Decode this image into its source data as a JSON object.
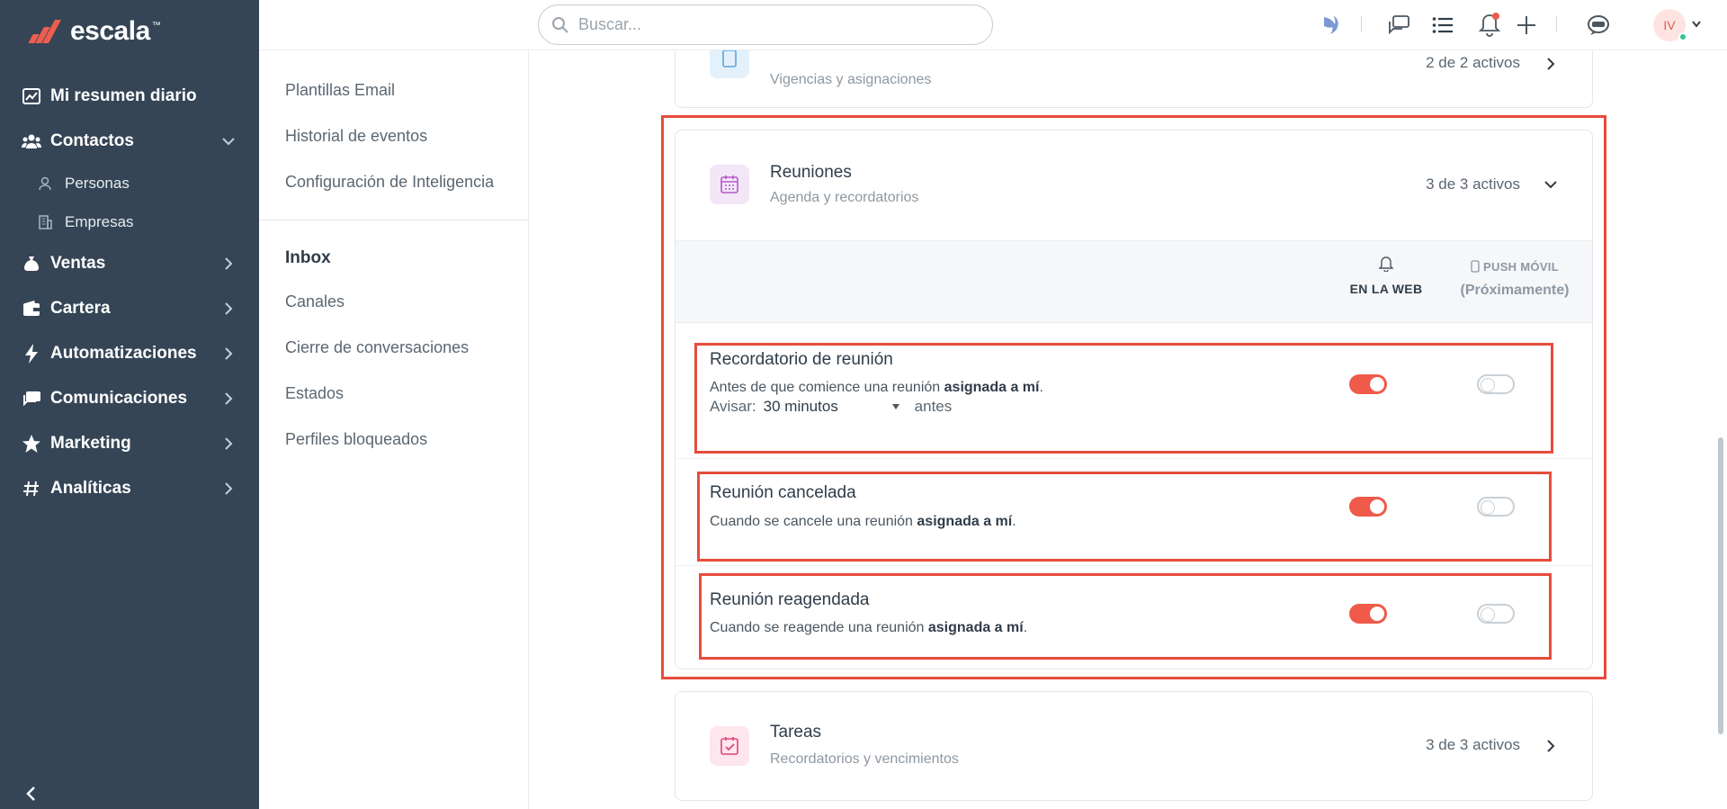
{
  "brand": {
    "name": "escala",
    "tm": "™"
  },
  "sidebar": {
    "items": [
      {
        "label": "Mi resumen diario",
        "icon": "chart-icon"
      },
      {
        "label": "Contactos",
        "icon": "contacts-icon",
        "expanded": true,
        "children": [
          {
            "label": "Personas",
            "icon": "person-icon"
          },
          {
            "label": "Empresas",
            "icon": "building-icon"
          }
        ]
      },
      {
        "label": "Ventas",
        "icon": "money-bag-icon"
      },
      {
        "label": "Cartera",
        "icon": "wallet-icon"
      },
      {
        "label": "Automatizaciones",
        "icon": "bolt-icon"
      },
      {
        "label": "Comunicaciones",
        "icon": "chat-icon"
      },
      {
        "label": "Marketing",
        "icon": "star-icon"
      },
      {
        "label": "Analíticas",
        "icon": "hash-icon"
      }
    ]
  },
  "submenu": {
    "links_top": [
      "Plantillas Email",
      "Historial de eventos",
      "Configuración de Inteligencia"
    ],
    "section": "Inbox",
    "links_inbox": [
      "Canales",
      "Cierre de conversaciones",
      "Estados",
      "Perfiles bloqueados"
    ]
  },
  "topbar": {
    "search_placeholder": "Buscar...",
    "avatar_initials": "IV"
  },
  "cards": {
    "prev": {
      "subtitle": "Vigencias y asignaciones",
      "count": "2 de 2 activos"
    },
    "reuniones": {
      "title": "Reuniones",
      "subtitle": "Agenda y recordatorios",
      "count": "3 de 3 activos",
      "col_web": "EN LA WEB",
      "col_push": "PUSH MÓVIL",
      "col_push_note": "(Próximamente)",
      "rows": [
        {
          "title": "Recordatorio de reunión",
          "desc": "Antes de que comience una reunión",
          "desc_bold": "asignada a mí",
          "web": true,
          "push": false
        },
        {
          "title": "Reunión cancelada",
          "desc": "Cuando se cancele una reunión",
          "desc_bold": "asignada a mí",
          "web": true,
          "push": false
        },
        {
          "title": "Reunión reagendada",
          "desc": "Cuando se reagende una reunión",
          "desc_bold": "asignada a mí",
          "web": true,
          "push": false
        }
      ],
      "avisar_label": "Avisar:",
      "avisar_value": "30 minutos",
      "avisar_after": "antes"
    },
    "tareas": {
      "title": "Tareas",
      "subtitle": "Recordatorios y vencimientos",
      "count": "3 de 3 activos"
    }
  },
  "colors": {
    "accent": "#ef5a4b",
    "sidebar": "#354556",
    "highlight": "#e74c3c"
  }
}
